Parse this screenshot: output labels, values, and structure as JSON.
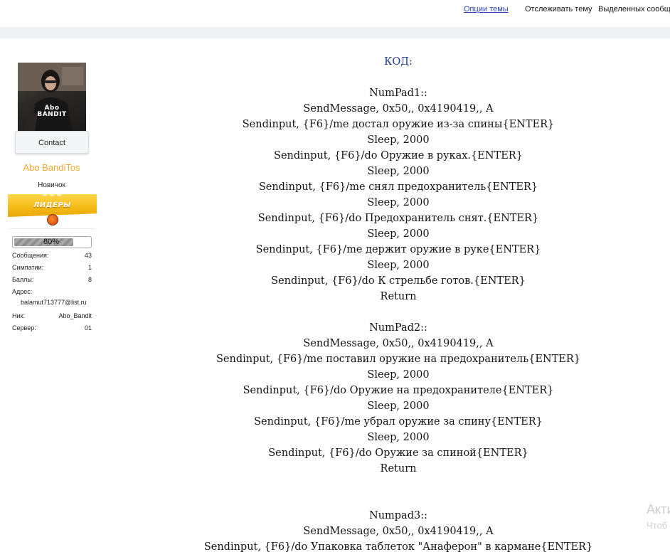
{
  "topbar": {
    "options_link": "Опции темы",
    "watch": "Отслеживать тему",
    "selected_messages": "Выделенных сообщений"
  },
  "user": {
    "avatar_text_line1": "Abo",
    "avatar_text_line2": "BANDIT",
    "contact_label": "Contact",
    "username": "Abo BandiTos",
    "title": "Новичок",
    "leader_banner": "ЛИДЕРЫ",
    "progress_percent": 80,
    "progress_label": "80%",
    "stats": {
      "messages_label": "Сообщения:",
      "messages_value": "43",
      "likes_label": "Симпатии:",
      "likes_value": "1",
      "points_label": "Баллы:",
      "points_value": "8",
      "address_label": "Адрес:",
      "address_value": "balamut713777@list.ru",
      "nick_label": "Ник:",
      "nick_value": "Abo_Bandit",
      "server_label": "Сервер:",
      "server_value": "01"
    },
    "colors": {
      "username": "#f0a830",
      "banner": "#f4b914"
    }
  },
  "post": {
    "code_label": "КОД:",
    "blocks": [
      {
        "lines": [
          "NumPad1::",
          "SendMessage, 0x50,, 0x4190419,, A",
          "Sendinput, {F6}/me достал оружие из-за спины{ENTER}",
          "Sleep, 2000",
          "Sendinput, {F6}/do Оружие в руках.{ENTER}",
          "Sleep, 2000",
          "Sendinput, {F6}/me снял предохранитель{ENTER}",
          "Sleep, 2000",
          "Sendinput, {F6}/do Предохранитель снят.{ENTER}",
          "Sleep, 2000",
          "Sendinput, {F6}/me держит оружие в руке{ENTER}",
          "Sleep, 2000",
          "Sendinput, {F6}/do К стрельбе готов.{ENTER}",
          "Return"
        ]
      },
      {
        "lines": [
          "NumPad2::",
          "SendMessage, 0x50,, 0x4190419,, A",
          "Sendinput, {F6}/me поставил оружие на предохранитель{ENTER}",
          "Sleep, 2000",
          "Sendinput, {F6}/do Оружие на предохранителе{ENTER}",
          "Sleep, 2000",
          "Sendinput, {F6}/me убрал оружие за спину{ENTER}",
          "Sleep, 2000",
          "Sendinput, {F6}/do Оружие за спиной{ENTER}",
          "Return"
        ]
      },
      {
        "lines": [
          "Numpad3::",
          "SendMessage, 0x50,, 0x4190419,, A",
          "Sendinput, {F6}/do Упаковка таблеток \"Анаферон\" в кармане{ENTER}"
        ]
      }
    ]
  },
  "watermark": {
    "line1": "Акти",
    "line2": "Чтоб"
  }
}
